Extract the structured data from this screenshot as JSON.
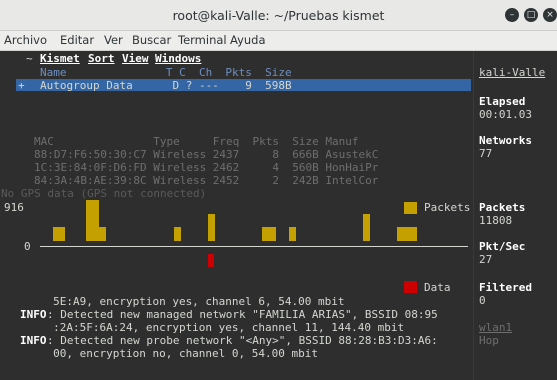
{
  "window": {
    "title": "root@kali-Valle: ~/Pruebas kismet",
    "buttons": [
      "minimize",
      "maximize",
      "close"
    ]
  },
  "menubar": [
    "Archivo",
    "Editar",
    "Ver",
    "Buscar",
    "Terminal",
    "Ayuda"
  ],
  "kismet_menu": {
    "marker": "~",
    "items": [
      "Kismet",
      "Sort",
      "View",
      "Windows"
    ]
  },
  "network_list": {
    "header": "Name               T C  Ch  Pkts  Size",
    "selected_row": {
      "marker": "+",
      "text": "Autogroup Data      D ? ---    9  598B"
    }
  },
  "client_list": {
    "header": "MAC               Type     Freq  Pkts  Size Manuf",
    "rows": [
      "88:D7:F6:50:30:C7 Wireless 2437     8  666B AsustekC",
      "1C:3E:84:0F:D6:FD Wireless 2462     4  560B HonHaiPr",
      "84:3A:4B:AE:39:8C Wireless 2452     2  242B IntelCor"
    ]
  },
  "gps_status": "No GPS data (GPS not connected)",
  "graph": {
    "y_max": "916",
    "y_zero": "0",
    "legend_packets": "Packets",
    "legend_data": "Data",
    "packets_color": "#c4a000",
    "data_color": "#cc0000"
  },
  "sidebar": {
    "hostname": "kali-Valle",
    "elapsed_label": "Elapsed",
    "elapsed_value": "00:01.03",
    "networks_label": "Networks",
    "networks_value": "77",
    "packets_label": "Packets",
    "packets_value": "11808",
    "pktsec_label": "Pkt/Sec",
    "pktsec_value": "27",
    "filtered_label": "Filtered",
    "filtered_value": "0",
    "source_iface": "wlan1",
    "source_status": "Hop"
  },
  "log": [
    {
      "prefix": "",
      "text": "     5E:A9, encryption yes, channel 6, 54.00 mbit"
    },
    {
      "prefix": "INFO",
      "text": ": Detected new managed network \"FAMILIA ARIAS\", BSSID 08:95"
    },
    {
      "prefix": "",
      "text": "     :2A:5F:6A:24, encryption yes, channel 11, 144.40 mbit"
    },
    {
      "prefix": "INFO",
      "text": ": Detected new probe network \"<Any>\", BSSID 88:28:B3:D3:A6:"
    },
    {
      "prefix": "",
      "text": "     00, encryption no, channel 0, 54.00 mbit"
    }
  ]
}
